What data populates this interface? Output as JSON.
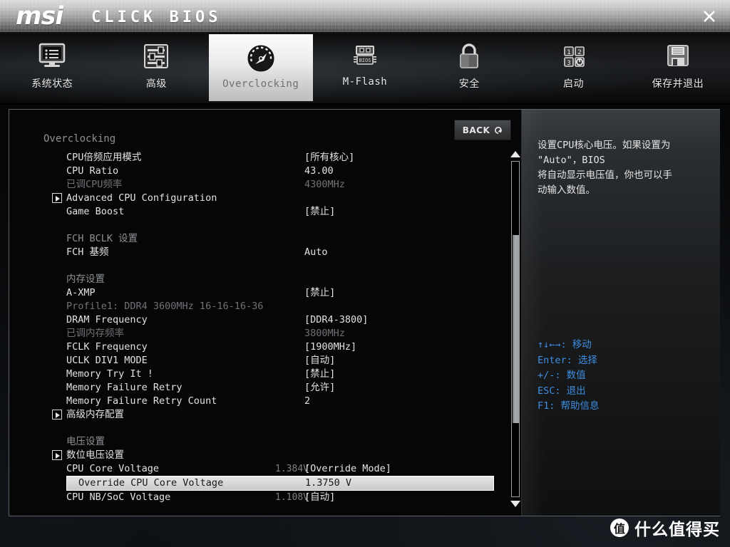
{
  "titlebar": {
    "brand": "msi",
    "product": "CLICK BIOS",
    "close_label": "close-icon"
  },
  "nav": {
    "items": [
      {
        "label": "系统状态",
        "icon": "monitor-icon",
        "active": false
      },
      {
        "label": "高级",
        "icon": "sliders-icon",
        "active": false
      },
      {
        "label": "Overclocking",
        "icon": "gauge-icon",
        "active": true
      },
      {
        "label": "M-Flash",
        "icon": "bios-chip-icon",
        "active": false
      },
      {
        "label": "安全",
        "icon": "lock-icon",
        "active": false
      },
      {
        "label": "启动",
        "icon": "boot-order-icon",
        "active": false
      },
      {
        "label": "保存并退出",
        "icon": "floppy-disk-icon",
        "active": false
      }
    ]
  },
  "main": {
    "back_label": "BACK",
    "section_title": "Overclocking",
    "rows": [
      {
        "label": "CPU倍频应用模式",
        "aux": "",
        "value": "[所有核心]",
        "style": "normal",
        "expander": false,
        "selected": false
      },
      {
        "label": "CPU Ratio",
        "aux": "",
        "value": "43.00",
        "style": "normal",
        "expander": false,
        "selected": false
      },
      {
        "label": "已调CPU频率",
        "aux": "",
        "value": "4300MHz",
        "style": "dim",
        "expander": false,
        "selected": false
      },
      {
        "label": "Advanced CPU Configuration",
        "aux": "",
        "value": "",
        "style": "normal",
        "expander": true,
        "selected": false
      },
      {
        "label": "Game Boost",
        "aux": "",
        "value": "[禁止]",
        "style": "normal",
        "expander": false,
        "selected": false
      },
      {
        "label": "",
        "aux": "",
        "value": "",
        "style": "spacer",
        "expander": false,
        "selected": false
      },
      {
        "label": "FCH BCLK 设置",
        "aux": "",
        "value": "",
        "style": "header",
        "expander": false,
        "selected": false
      },
      {
        "label": "FCH 基频",
        "aux": "",
        "value": "Auto",
        "style": "normal",
        "expander": false,
        "selected": false
      },
      {
        "label": "",
        "aux": "",
        "value": "",
        "style": "spacer",
        "expander": false,
        "selected": false
      },
      {
        "label": "内存设置",
        "aux": "",
        "value": "",
        "style": "header",
        "expander": false,
        "selected": false
      },
      {
        "label": "A-XMP",
        "aux": "",
        "value": "[禁止]",
        "style": "normal",
        "expander": false,
        "selected": false
      },
      {
        "label": "Profile1: DDR4 3600MHz 16-16-16-36",
        "aux": "",
        "value": "",
        "style": "dim",
        "expander": false,
        "selected": false
      },
      {
        "label": "DRAM Frequency",
        "aux": "",
        "value": "[DDR4-3800]",
        "style": "normal",
        "expander": false,
        "selected": false
      },
      {
        "label": "已调内存频率",
        "aux": "",
        "value": "3800MHz",
        "style": "dim",
        "expander": false,
        "selected": false
      },
      {
        "label": "FCLK Frequency",
        "aux": "",
        "value": "[1900MHz]",
        "style": "normal",
        "expander": false,
        "selected": false
      },
      {
        "label": "UCLK DIV1 MODE",
        "aux": "",
        "value": "[自动]",
        "style": "normal",
        "expander": false,
        "selected": false
      },
      {
        "label": "Memory Try It !",
        "aux": "",
        "value": "[禁止]",
        "style": "normal",
        "expander": false,
        "selected": false
      },
      {
        "label": "Memory Failure Retry",
        "aux": "",
        "value": "[允许]",
        "style": "normal",
        "expander": false,
        "selected": false
      },
      {
        "label": "Memory Failure Retry Count",
        "aux": "",
        "value": "2",
        "style": "normal",
        "expander": false,
        "selected": false
      },
      {
        "label": "高级内存配置",
        "aux": "",
        "value": "",
        "style": "normal",
        "expander": true,
        "selected": false
      },
      {
        "label": "",
        "aux": "",
        "value": "",
        "style": "spacer",
        "expander": false,
        "selected": false
      },
      {
        "label": "电压设置",
        "aux": "",
        "value": "",
        "style": "header",
        "expander": false,
        "selected": false
      },
      {
        "label": "数位电压设置",
        "aux": "",
        "value": "",
        "style": "normal",
        "expander": true,
        "selected": false
      },
      {
        "label": "CPU Core Voltage",
        "aux": "1.384V",
        "value": "[Override Mode]",
        "style": "normal",
        "expander": false,
        "selected": false
      },
      {
        "label": "Override CPU Core Voltage",
        "aux": "",
        "value": "1.3750 V",
        "style": "normal",
        "expander": false,
        "selected": true
      },
      {
        "label": "CPU NB/SoC Voltage",
        "aux": "1.108V",
        "value": "[自动]",
        "style": "normal",
        "expander": false,
        "selected": false
      }
    ]
  },
  "scrollbar": {
    "thumb_top_pct": 22,
    "thumb_height_pct": 56
  },
  "help": {
    "description": "设置CPU核心电压。如果设置为\n\"Auto\"，BIOS\n将自动显示电压值，你也可以手\n动输入数值。",
    "keys": [
      "↑↓←→: 移动",
      "Enter: 选择",
      "+/-: 数值",
      "ESC: 退出",
      "F1: 帮助信息"
    ]
  },
  "watermark": {
    "badge": "值",
    "text": "什么值得买"
  },
  "colors": {
    "accent_blue": "#3f8ee0",
    "text_primary": "#e3e3e3",
    "text_dim": "#6f7276",
    "header_gray": "#8e9194",
    "selected_bg": "#d9d9d9"
  }
}
